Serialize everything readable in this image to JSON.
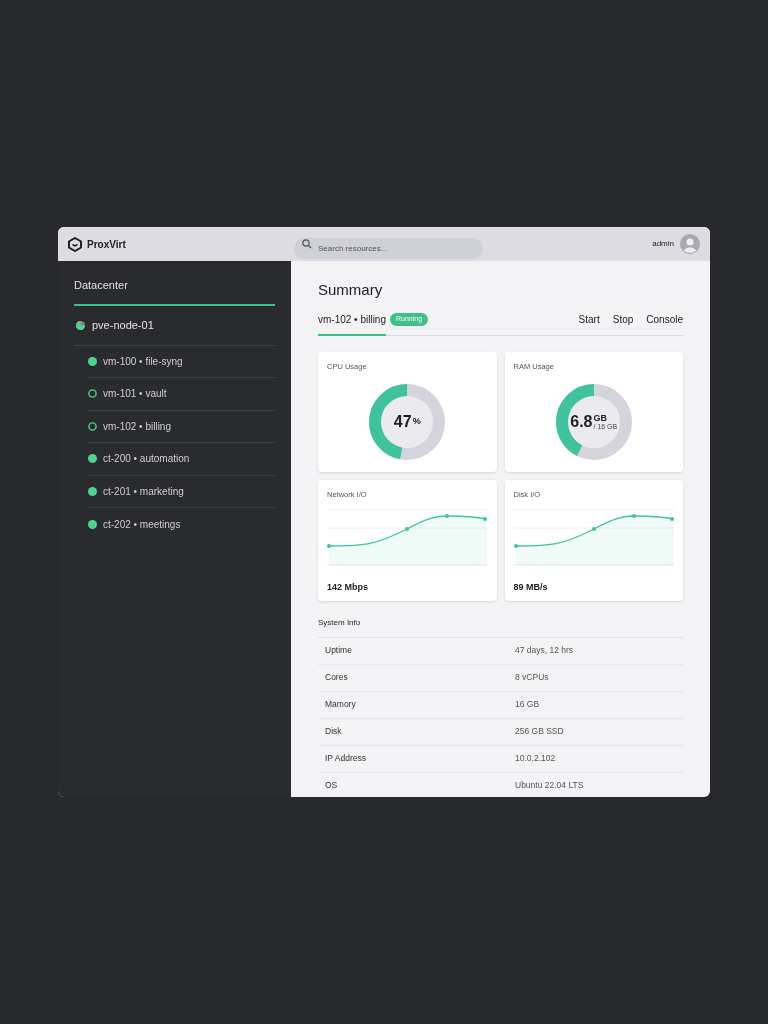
{
  "app": {
    "name": "ProxVirt"
  },
  "search": {
    "placeholder": "Search resources..."
  },
  "user": {
    "name": "admin"
  },
  "sidebar": {
    "title": "Datacenter",
    "node": "pve-node-01",
    "items": [
      {
        "label": "vm-100 • file-syng",
        "running": true
      },
      {
        "label": "vm-101 • vault",
        "running": false
      },
      {
        "label": "vm-102 • billing",
        "running": false
      },
      {
        "label": "ct-200 • automation",
        "running": true
      },
      {
        "label": "ct-201 • marketing",
        "running": true
      },
      {
        "label": "ct-202 • meetings",
        "running": true
      }
    ]
  },
  "main": {
    "title": "Summary",
    "vm_tab": {
      "label": "vm-102 • billing",
      "selected": true
    },
    "status_badge": "Running",
    "actions": [
      "Start",
      "Stop",
      "Console"
    ],
    "gauges": [
      {
        "title": "CPU Usage",
        "value": "47",
        "unit": "%",
        "level": 0.47
      },
      {
        "title": "RAM Usage",
        "value": "6.8",
        "unit": "GB",
        "sub": "/ 16 GB",
        "level": 0.425
      }
    ],
    "io_cards": [
      {
        "title": "Network I/O",
        "reading": "142 Mbps"
      },
      {
        "title": "Disk I/O",
        "reading": "89 MB/s"
      }
    ],
    "system_info": {
      "title": "System Info",
      "rows": [
        {
          "label": "Uptime",
          "value": "47 days, 12 hrs"
        },
        {
          "label": "Cores",
          "value": "8 vCPUs"
        },
        {
          "label": "Mamory",
          "value": "16 GB"
        },
        {
          "label": "Disk",
          "value": "256 GB SSD"
        },
        {
          "label": "IP Address",
          "value": "10.0.2.102"
        },
        {
          "label": "OS",
          "value": "Ubuntu 22.04 LTS"
        }
      ]
    }
  }
}
